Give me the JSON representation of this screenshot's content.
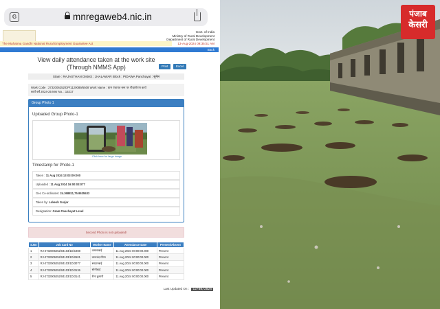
{
  "browser": {
    "url": "mnregaweb4.nic.in",
    "translate_icon": "translate-icon",
    "lock_icon": "lock-icon",
    "share_icon": "share-icon"
  },
  "header": {
    "gov_line1": "Govt. of India",
    "gov_line2": "Ministry of Rural Development",
    "gov_line3": "Department of Rural Development",
    "date_line": "13-Aug-2024 09:35:51 AM",
    "scheme_name": "The Mahatma Gandhi National Rural Employment Guarantee Act",
    "back_label": "Back"
  },
  "page": {
    "title": "View daily attendance taken at the work site (Through NMMS App)",
    "print_label": "Print",
    "excel_label": "Excel",
    "state_line": "State : RAJASTHAN District : JHALAWAR Block : PIDAWA Panchayat : सुनेल",
    "work_line1": "Work Code : 2732006252/DP/1120089/5508 Work Name : ग्राम पंचायत स्तर पर पौधारोपण कार्य",
    "work_line2": "कार्य वर्ष 2024-25 Msr No. : 15217"
  },
  "group_photo": {
    "panel_title": "Group Photo 1",
    "uploaded_title": "Uploaded Group Photo-1",
    "click_label": "Click here for large image",
    "timestamp_title": "Timestamp for Photo-1",
    "taken_label": "Taken :",
    "taken_value": "11 Aug 2024 13:03:09:000",
    "uploaded_label": "Uploaded :",
    "uploaded_value": "11 Aug 2024 16:00:03:077",
    "geo_label": "Geo Co-ordinates:",
    "geo_value": "24.368811,75.9535533",
    "taken_by_label": "Taken by:",
    "taken_by_value": "Lokesh Gurjar",
    "designation_label": "Designation:",
    "designation_value": "Gram Panchayat Level"
  },
  "alert": {
    "text": "Second Photo is not uploaded!"
  },
  "attendance": {
    "headers": [
      "S.No",
      "Job Card No",
      "Worker Name",
      "Attendance Date",
      "Present/Absent"
    ],
    "rows": [
      [
        "1",
        "RJ-2732006252/04103/1D/1988",
        "कमलाबाई",
        "11 Aug 2024 00:00:00.000",
        "Present"
      ],
      [
        "2",
        "RJ-2732006252/04103/1D/2601",
        "लालचंद मीणा",
        "11 Aug 2024 00:00:00.000",
        "Present"
      ],
      [
        "3",
        "RJ-2732006252/04103/1D/3077",
        "सरदारबाई",
        "11 Aug 2024 00:00:00.000",
        "Present"
      ],
      [
        "4",
        "RJ-2732006252/04103/1D/3136",
        "सोनीबाई",
        "11 Aug 2024 00:00:00.000",
        "Present"
      ],
      [
        "5",
        "RJ-2732006252/04103/1D/3141",
        "रीना कुमारी",
        "11 Aug 2024 00:00:00.000",
        "Present"
      ]
    ]
  },
  "footer": {
    "updated_label": "Last Updated On :",
    "updated_value": "12/08/2024"
  },
  "photo_overlay": {
    "logo_line1": "पंजाब",
    "logo_line2": "केसरी"
  }
}
